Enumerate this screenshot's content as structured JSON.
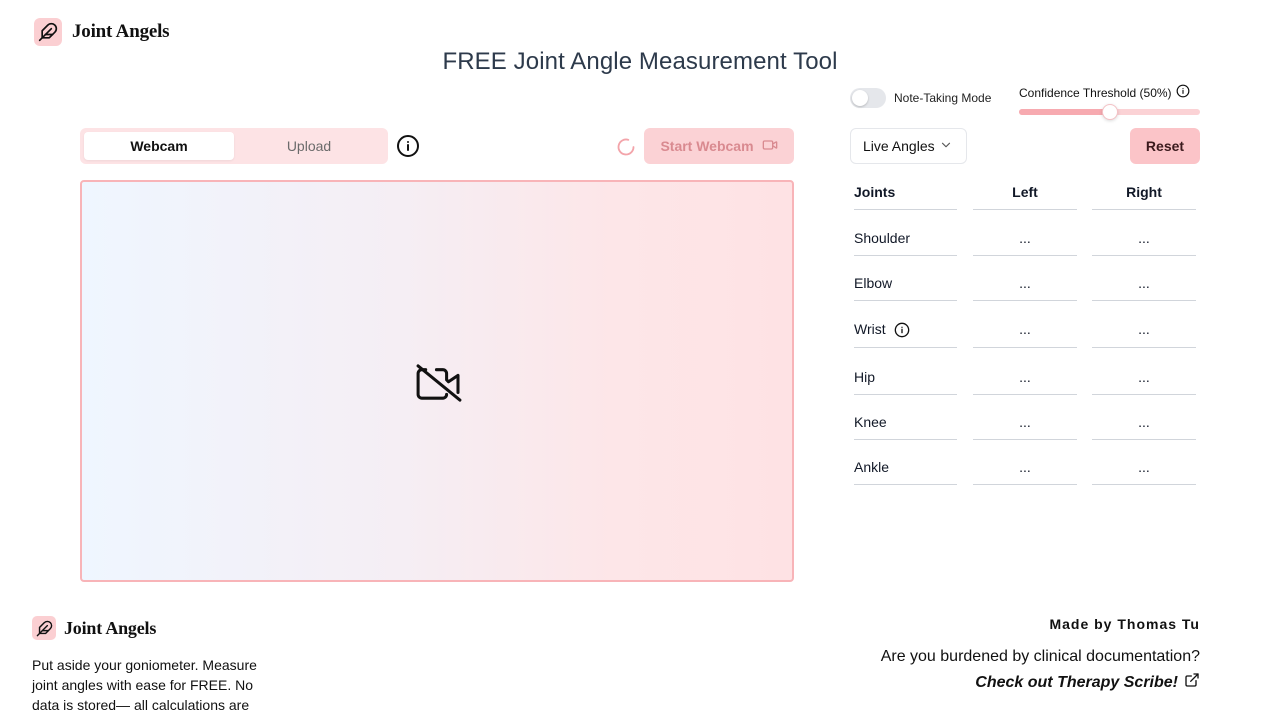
{
  "header": {
    "logo_text": "Joint Angels",
    "title": "FREE Joint Angle Measurement Tool"
  },
  "mode_tabs": [
    {
      "label": "Webcam",
      "active": true
    },
    {
      "label": "Upload",
      "active": false
    }
  ],
  "webcam": {
    "start_label": "Start Webcam"
  },
  "controls": {
    "note_taking_label": "Note-Taking Mode",
    "note_taking_on": false,
    "confidence_label": "Confidence Threshold (50%)",
    "confidence_value": 0.5,
    "angle_select_value": "Live Angles",
    "reset_label": "Reset"
  },
  "joints_table": {
    "headers": [
      "Joints",
      "Left",
      "Right"
    ],
    "rows": [
      {
        "joint": "Shoulder",
        "left": "...",
        "right": "...",
        "info": false
      },
      {
        "joint": "Elbow",
        "left": "...",
        "right": "...",
        "info": false
      },
      {
        "joint": "Wrist",
        "left": "...",
        "right": "...",
        "info": true
      },
      {
        "joint": "Hip",
        "left": "...",
        "right": "...",
        "info": false
      },
      {
        "joint": "Knee",
        "left": "...",
        "right": "...",
        "info": false
      },
      {
        "joint": "Ankle",
        "left": "...",
        "right": "...",
        "info": false
      }
    ]
  },
  "footer": {
    "logo_text": "Joint Angels",
    "tagline": "Put aside your goniometer. Measure joint angles with ease for FREE. No data is stored— all calculations are done in your browser.",
    "made_by": "Made by Thomas Tu",
    "burden_text": "Are you burdened by clinical documentation?",
    "link_text": "Check out Therapy Scribe!"
  },
  "colors": {
    "accent": "#fbc4c8",
    "accent_light": "#fde3e5",
    "border_accent": "#f8b4b8",
    "title": "#2d3a4b"
  },
  "icons": {
    "logo": "feather-icon",
    "info": "info-icon",
    "spinner": "loading-spinner-icon",
    "video": "video-camera-icon",
    "video_off": "video-off-icon",
    "chevron": "chevron-down-icon",
    "external": "external-link-icon"
  }
}
